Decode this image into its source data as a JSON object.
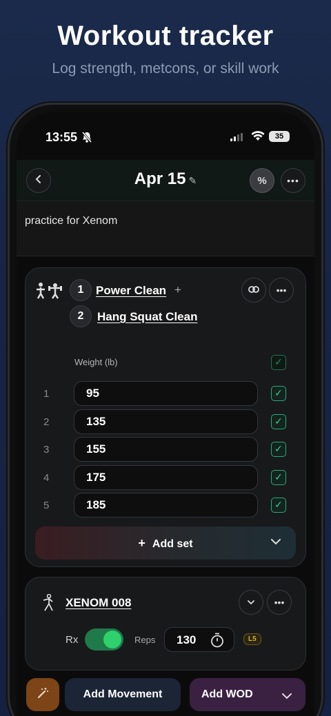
{
  "hero": {
    "title": "Workout tracker",
    "subtitle": "Log strength, metcons, or skill work"
  },
  "status_bar": {
    "time": "13:55",
    "battery": "35"
  },
  "nav": {
    "title": "Apr 15",
    "percent_label": "%"
  },
  "note": "practice for Xenom",
  "strength_block": {
    "movements": [
      {
        "num": "1",
        "name": "Power Clean",
        "suffix": "+"
      },
      {
        "num": "2",
        "name": "Hang Squat Clean"
      }
    ],
    "column_header": "Weight (lb)",
    "sets": [
      {
        "index": "1",
        "weight": "95",
        "done": true
      },
      {
        "index": "2",
        "weight": "135",
        "done": true
      },
      {
        "index": "3",
        "weight": "155",
        "done": true
      },
      {
        "index": "4",
        "weight": "175",
        "done": true
      },
      {
        "index": "5",
        "weight": "185",
        "done": true
      }
    ],
    "add_set_label": "Add set",
    "add_set_icon": "+"
  },
  "wod_block": {
    "name": "XENOM 008",
    "rx_label": "Rx",
    "rx_enabled": true,
    "reps_label": "Reps",
    "reps_value": "130",
    "level_badge": "L5"
  },
  "bottom_bar": {
    "add_movement": "Add Movement",
    "add_wod": "Add WOD"
  },
  "colors": {
    "accent_green": "#2ed16b",
    "check_green": "#48c792",
    "badge_gold": "#d9b13a",
    "wand_orange": "#8a4a1a",
    "wod_purple": "#3a2142"
  }
}
